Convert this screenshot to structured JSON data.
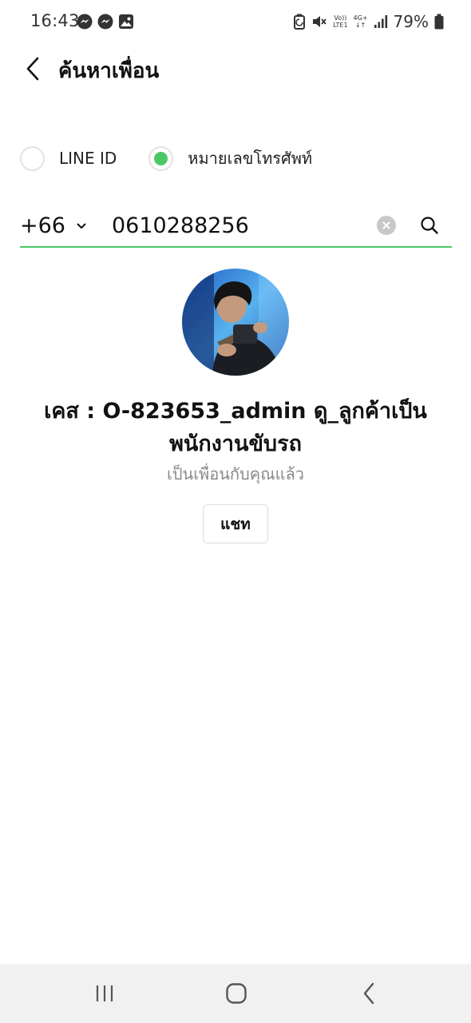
{
  "status_bar": {
    "time": "16:43",
    "battery_percent": "79%",
    "volte_top": "Vo))",
    "volte_bottom": "LTE1",
    "network_type": "4G+",
    "network_arrows": "↓↑",
    "icons": [
      "messenger-icon",
      "messenger-icon",
      "gallery-icon",
      "battery-saver-icon",
      "mute-icon",
      "signal-icon",
      "battery-icon"
    ]
  },
  "header": {
    "title": "ค้นหาเพื่อน"
  },
  "search_type": {
    "options": [
      {
        "label": "LINE ID",
        "selected": false
      },
      {
        "label": "หมายเลขโทรศัพท์",
        "selected": true
      }
    ]
  },
  "phone_search": {
    "country_code": "+66",
    "value": "0610288256"
  },
  "result": {
    "name": "เคส : O-823653_admin ดู_ลูกค้าเป็นพนักงานขับรถ",
    "status": "เป็นเพื่อนกับคุณแล้ว",
    "chat_label": "แชท"
  },
  "colors": {
    "accent": "#4cc764",
    "radio_border": "#e2e2e2",
    "secondary_text": "#8a8a8a",
    "nav_bg": "#f1f1f1"
  }
}
